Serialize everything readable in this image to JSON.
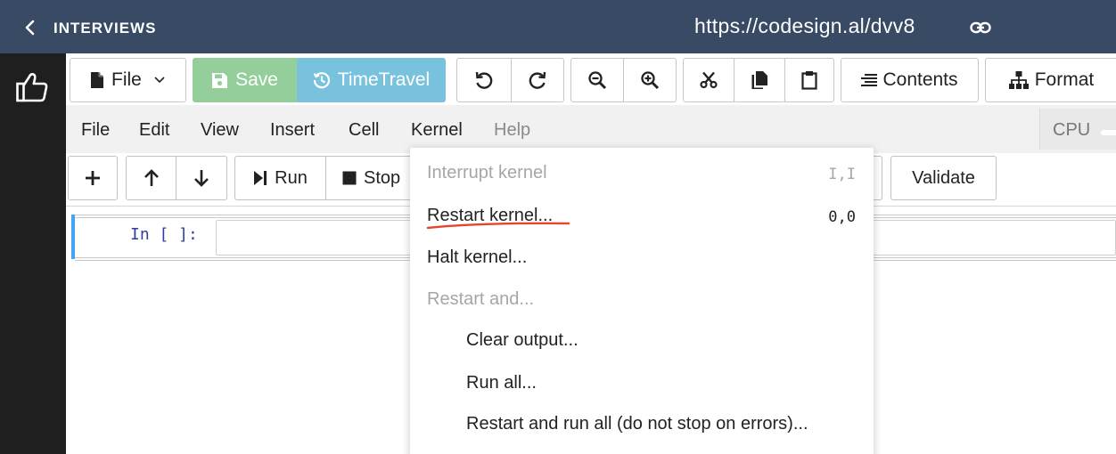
{
  "header": {
    "back_icon": "chevron-left-icon",
    "title": "INTERVIEWS",
    "url": "https://codesign.al/dvv8",
    "link_icon": "link-icon",
    "bg_color": "#384a64"
  },
  "sidebar": {
    "icon": "thumbs-up-icon"
  },
  "toolbar": {
    "file_label": "File",
    "save_label": "Save",
    "timetravel_label": "TimeTravel",
    "contents_label": "Contents",
    "format_label": "Format",
    "save_color": "#93ce9b",
    "timetravel_color": "#79c2de"
  },
  "menubar": {
    "items": [
      "File",
      "Edit",
      "View",
      "Insert",
      "Cell",
      "Kernel",
      "Help"
    ],
    "cpu_label": "CPU"
  },
  "nbtoolbar": {
    "run_label": "Run",
    "stop_label": "Stop",
    "validate_label": "Validate"
  },
  "cell": {
    "prompt": "In [ ]:"
  },
  "kernel_menu": {
    "interrupt": {
      "label": "Interrupt kernel",
      "shortcut": "I,I"
    },
    "restart": {
      "label": "Restart kernel...",
      "shortcut": "0,0"
    },
    "halt": {
      "label": "Halt kernel..."
    },
    "restart_and": {
      "label": "Restart and..."
    },
    "clear_output": {
      "label": "Clear output..."
    },
    "run_all": {
      "label": "Run all..."
    },
    "restart_run_all": {
      "label": "Restart and run all (do not stop on errors)..."
    },
    "annotation_color": "#e8442c"
  }
}
